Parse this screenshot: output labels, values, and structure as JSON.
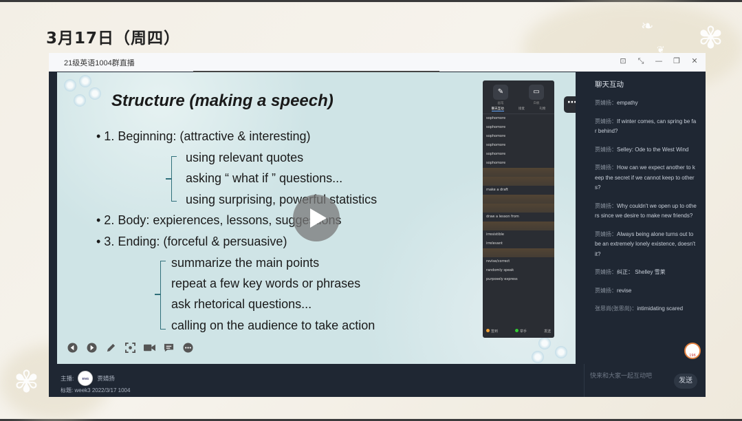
{
  "page": {
    "date_heading": "3月17日（周四）"
  },
  "window": {
    "title": "21级英语1004群直播",
    "controls": [
      "pin-icon",
      "shrink-icon",
      "minimize-icon",
      "restore-icon",
      "close-icon"
    ]
  },
  "slide": {
    "title": "Structure (making a speech)",
    "lines": [
      "• 1. Beginning: (attractive & interesting)",
      "using relevant quotes",
      "asking “ what if ” questions...",
      "using surprising, powerful statistics",
      "• 2. Body: expierences, lessons, suggestions",
      "• 3. Ending: (forceful & persuasive)",
      "summarize the main points",
      "repeat a few key words or phrases",
      "ask rhetorical questions...",
      "calling on the audience to take action"
    ]
  },
  "player_controls": [
    "prev-icon",
    "next-icon",
    "pen-icon",
    "screenshot-icon",
    "camera-icon",
    "comment-icon",
    "more-icon"
  ],
  "mini_chat": {
    "tools": [
      "画笔",
      "白板"
    ],
    "tabs": [
      "聊天互动",
      "接麦",
      "礼物"
    ],
    "rows": [
      {
        "n": "",
        "t": "sophomore",
        "orange": false
      },
      {
        "n": "",
        "t": "sophomore",
        "orange": false
      },
      {
        "n": "",
        "t": "sophomore",
        "orange": false
      },
      {
        "n": "",
        "t": "sophomore",
        "orange": false
      },
      {
        "n": "",
        "t": "sophomore",
        "orange": false
      },
      {
        "n": "",
        "t": "sophomore",
        "orange": false
      },
      {
        "n": "",
        "t": "",
        "orange": true
      },
      {
        "n": "",
        "t": "",
        "orange": true
      },
      {
        "n": "",
        "t": "make a draft",
        "orange": false
      },
      {
        "n": "",
        "t": "",
        "orange": true
      },
      {
        "n": "",
        "t": "",
        "orange": true
      },
      {
        "n": "",
        "t": "draw a lesson from",
        "orange": false
      },
      {
        "n": "",
        "t": "",
        "orange": true
      },
      {
        "n": "",
        "t": "irresistible",
        "orange": false
      },
      {
        "n": "",
        "t": "irrelevant",
        "orange": false
      },
      {
        "n": "",
        "t": "",
        "orange": true
      },
      {
        "n": "",
        "t": "revise/correct",
        "orange": false
      },
      {
        "n": "",
        "t": "randomly speak",
        "orange": false
      },
      {
        "n": "",
        "t": "purposely express",
        "orange": false
      }
    ],
    "foot_left": "签到",
    "foot_mid": "举手",
    "foot_btn": "发送"
  },
  "chat": {
    "title": "聊天互动",
    "messages": [
      {
        "user": "贾婧扬：",
        "text": "empathy"
      },
      {
        "user": "贾婧扬：",
        "text": "If winter comes, can spring be far behind?"
      },
      {
        "user": "贾婧扬：",
        "text": "Selley: Ode to the West Wind"
      },
      {
        "user": "贾婧扬：",
        "text": "How can we expect another to keep the secret if we cannot keep to others?"
      },
      {
        "user": "贾婧扬：",
        "text": "Why couldn't we open up to others since we desire to make new friends?"
      },
      {
        "user": "贾婧扬：",
        "text": "Always being alone turns out to be an extremely lonely existence, doesn't it?"
      },
      {
        "user": "贾婧扬：",
        "text": "纠正：  Shelley 雪莱"
      },
      {
        "user": "贾婧扬：",
        "text": "revise"
      },
      {
        "user": "张思尚(张思尚)：",
        "text": "intimidating scared"
      }
    ],
    "avatar_count": "196"
  },
  "bottom": {
    "host_label": "主播:",
    "host_name": "贾婧扬",
    "tag_label": "标题:",
    "tag_value": "week3  2022/3/17  1004",
    "input_placeholder": "快来和大家一起互动吧",
    "send_label": "发送"
  }
}
